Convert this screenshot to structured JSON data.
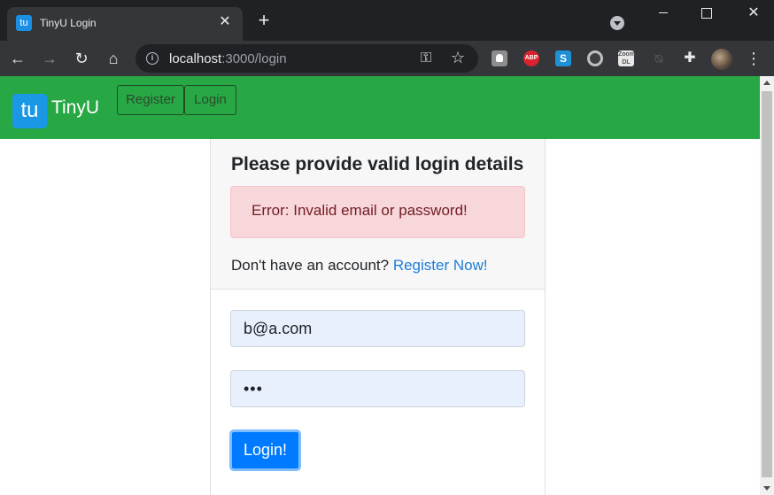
{
  "browser": {
    "tab_title": "TinyU Login",
    "tab_favicon": "tu",
    "url_host": "localhost",
    "url_rest": ":3000/login",
    "extensions": {
      "abp": "ABP",
      "s": "S",
      "zoom_line1": "Zoom",
      "zoom_line2": "DL"
    }
  },
  "navbar": {
    "logo": "tu",
    "brand": "TinyU",
    "links": [
      {
        "label": "Register"
      },
      {
        "label": "Login"
      }
    ],
    "color": "#28a745"
  },
  "login": {
    "title": "Please provide valid login details",
    "error": "Error: Invalid email or password!",
    "signup_prompt": "Don't have an account?",
    "signup_link": "Register Now!",
    "email_value": "b@a.com",
    "password_value": "•••",
    "submit_label": "Login!"
  },
  "colors": {
    "accent": "#007bff",
    "error_bg": "#f8d7da",
    "error_text": "#721c24",
    "link": "#1d7dd8"
  }
}
